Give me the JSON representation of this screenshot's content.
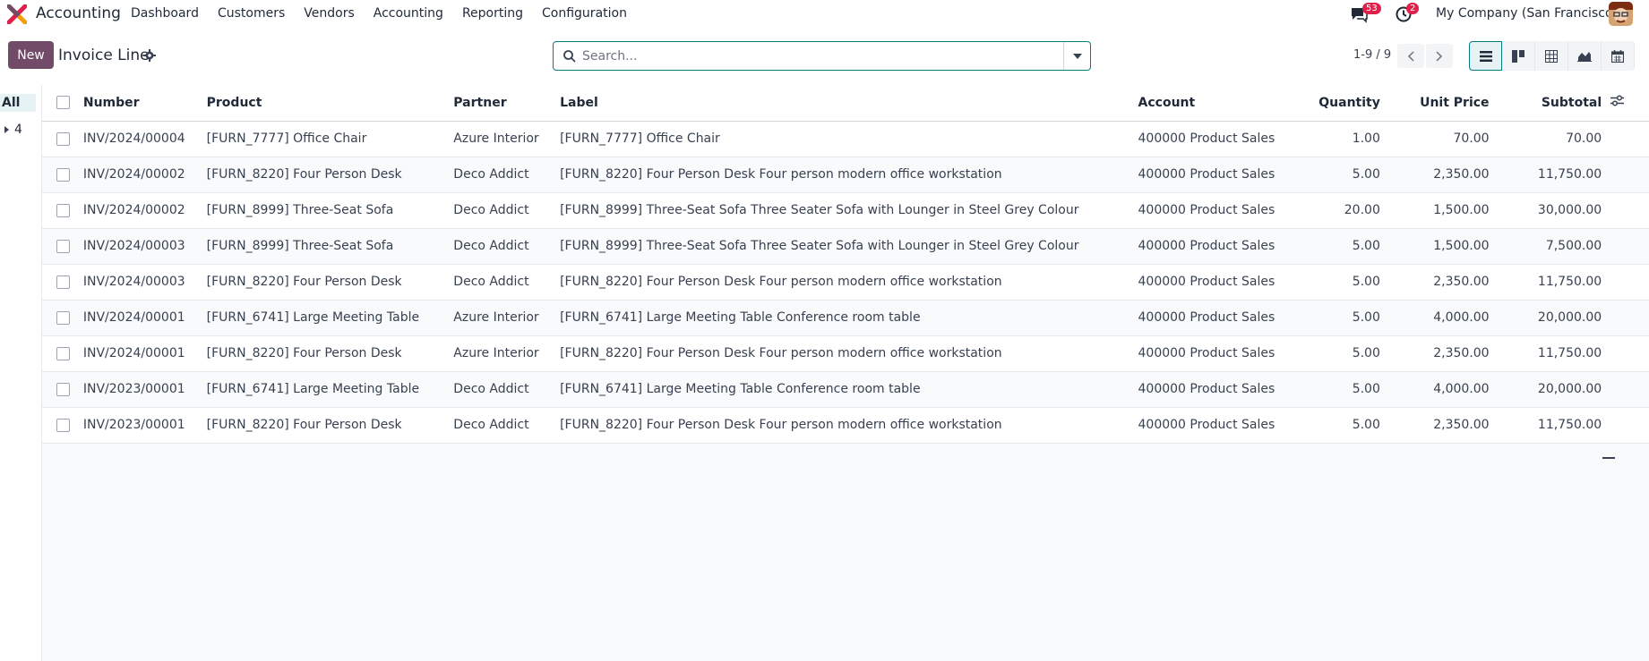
{
  "app": {
    "name": "Accounting",
    "menu": [
      "Dashboard",
      "Customers",
      "Vendors",
      "Accounting",
      "Reporting",
      "Configuration"
    ],
    "chat_badge": "53",
    "activity_badge": "2",
    "company": "My Company (San Francisco)"
  },
  "control": {
    "new_label": "New",
    "title": "Invoice Line",
    "search_placeholder": "Search...",
    "pager": "1-9 / 9"
  },
  "side": {
    "all_label": "All",
    "group_label": "4"
  },
  "table": {
    "headers": {
      "number": "Number",
      "product": "Product",
      "partner": "Partner",
      "label": "Label",
      "account": "Account",
      "quantity": "Quantity",
      "unit_price": "Unit Price",
      "subtotal": "Subtotal"
    },
    "rows": [
      {
        "number": "INV/2024/00004",
        "product": "[FURN_7777] Office Chair",
        "partner": "Azure Interior",
        "label": "[FURN_7777] Office Chair",
        "account": "400000 Product Sales",
        "quantity": "1.00",
        "unit_price": "70.00",
        "subtotal": "70.00"
      },
      {
        "number": "INV/2024/00002",
        "product": "[FURN_8220] Four Person Desk",
        "partner": "Deco Addict",
        "label": "[FURN_8220] Four Person Desk Four person modern office workstation",
        "account": "400000 Product Sales",
        "quantity": "5.00",
        "unit_price": "2,350.00",
        "subtotal": "11,750.00"
      },
      {
        "number": "INV/2024/00002",
        "product": "[FURN_8999] Three-Seat Sofa",
        "partner": "Deco Addict",
        "label": "[FURN_8999] Three-Seat Sofa Three Seater Sofa with Lounger in Steel Grey Colour",
        "account": "400000 Product Sales",
        "quantity": "20.00",
        "unit_price": "1,500.00",
        "subtotal": "30,000.00"
      },
      {
        "number": "INV/2024/00003",
        "product": "[FURN_8999] Three-Seat Sofa",
        "partner": "Deco Addict",
        "label": "[FURN_8999] Three-Seat Sofa Three Seater Sofa with Lounger in Steel Grey Colour",
        "account": "400000 Product Sales",
        "quantity": "5.00",
        "unit_price": "1,500.00",
        "subtotal": "7,500.00"
      },
      {
        "number": "INV/2024/00003",
        "product": "[FURN_8220] Four Person Desk",
        "partner": "Deco Addict",
        "label": "[FURN_8220] Four Person Desk Four person modern office workstation",
        "account": "400000 Product Sales",
        "quantity": "5.00",
        "unit_price": "2,350.00",
        "subtotal": "11,750.00"
      },
      {
        "number": "INV/2024/00001",
        "product": "[FURN_6741] Large Meeting Table",
        "partner": "Azure Interior",
        "label": "[FURN_6741] Large Meeting Table Conference room table",
        "account": "400000 Product Sales",
        "quantity": "5.00",
        "unit_price": "4,000.00",
        "subtotal": "20,000.00"
      },
      {
        "number": "INV/2024/00001",
        "product": "[FURN_8220] Four Person Desk",
        "partner": "Azure Interior",
        "label": "[FURN_8220] Four Person Desk Four person modern office workstation",
        "account": "400000 Product Sales",
        "quantity": "5.00",
        "unit_price": "2,350.00",
        "subtotal": "11,750.00"
      },
      {
        "number": "INV/2023/00001",
        "product": "[FURN_6741] Large Meeting Table",
        "partner": "Deco Addict",
        "label": "[FURN_6741] Large Meeting Table Conference room table",
        "account": "400000 Product Sales",
        "quantity": "5.00",
        "unit_price": "4,000.00",
        "subtotal": "20,000.00"
      },
      {
        "number": "INV/2023/00001",
        "product": "[FURN_8220] Four Person Desk",
        "partner": "Deco Addict",
        "label": "[FURN_8220] Four Person Desk Four person modern office workstation",
        "account": "400000 Product Sales",
        "quantity": "5.00",
        "unit_price": "2,350.00",
        "subtotal": "11,750.00"
      }
    ]
  },
  "colors": {
    "brand": "#714b67",
    "accent": "#017e84",
    "badge": "#e0204a"
  }
}
